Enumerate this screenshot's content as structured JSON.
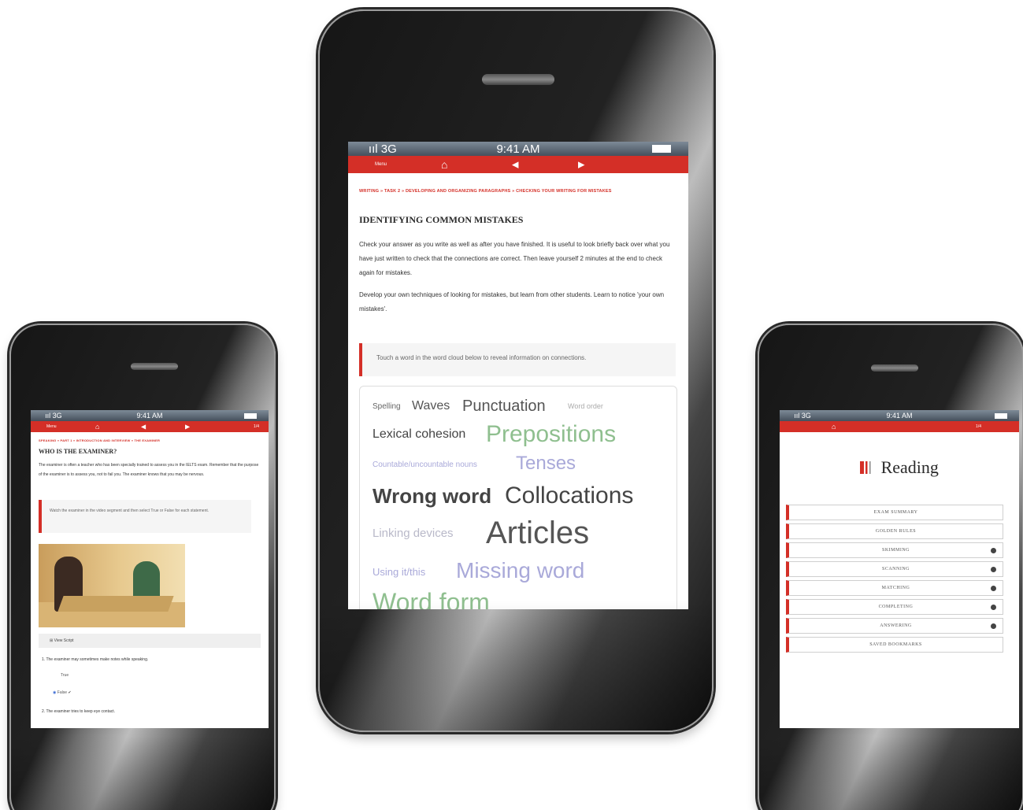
{
  "center": {
    "status": {
      "signal": "ııl 3G",
      "time": "9:41 AM"
    },
    "nav": {
      "menu": "Menu",
      "home_icon": "home-icon",
      "back_icon": "left-arrow-icon",
      "forward_icon": "right-arrow-icon"
    },
    "breadcrumb": "WRITING » TASK 2 » DEVELOPING AND ORGANIZING PARAGRAPHS » CHECKING YOUR WRITING FOR MISTAKES",
    "title": "IDENTIFYING COMMON MISTAKES",
    "paragraph1": "Check your answer as you write as well as after you have finished. It is useful to look briefly back over what you have just written to check that the connections are correct. Then leave yourself 2 minutes at the end to check again for mistakes.",
    "paragraph2": "Develop your own techniques of looking for mistakes, but learn from other students. Learn to notice 'your own mistakes'.",
    "callout": "Touch a word in the word cloud below to reveal information on connections.",
    "cloud": {
      "spelling": "Spelling",
      "waves": "Waves",
      "punctuation": "Punctuation",
      "word_order": "Word order",
      "lexical_cohesion": "Lexical cohesion",
      "prepositions": "Prepositions",
      "countable": "Countable/uncountable nouns",
      "tenses": "Tenses",
      "wrong_word": "Wrong word",
      "collocations": "Collocations",
      "linking_devices": "Linking devices",
      "articles": "Articles",
      "using_itthis": "Using it/this",
      "missing_word": "Missing word",
      "word_form": "Word form"
    },
    "colors": {
      "accent": "#d42f27",
      "green": "#8fbf8f",
      "lavender": "#a9a9d9",
      "gray_light": "#b9b9c9"
    }
  },
  "left": {
    "status": {
      "signal": "ııl 3G",
      "time": "9:41 AM"
    },
    "nav": {
      "menu": "Menu",
      "home_icon": "home-icon",
      "back_icon": "left-arrow-icon",
      "forward_icon": "right-arrow-icon",
      "extra": "1/4"
    },
    "breadcrumb": "SPEAKING » PART 1 » INTRODUCTION AND INTERVIEW » THE EXAMINER",
    "title": "WHO IS THE EXAMINER?",
    "paragraph": "The examiner is often a teacher who has been specially trained to assess you in the IELTS exam. Remember that the purpose of the examiner is to assess you, not to fail you. The examiner knows that you may be nervous.",
    "callout": "Watch the examiner in the video segment and then select True or False for each statement.",
    "video_toggle": "View Script",
    "q1": "1. The examiner may sometimes make notes while speaking.",
    "opt_true": "True",
    "opt_false": "False ✔",
    "q2": "2. The examiner tries to keep eye contact."
  },
  "right": {
    "status": {
      "signal": "ııl 3G",
      "time": "9:41 AM"
    },
    "nav": {
      "home_icon": "home-icon",
      "extra": "1/4"
    },
    "title": "Reading",
    "menu": [
      "EXAM SUMMARY",
      "GOLDEN RULES",
      "SKIMMING",
      "SCANNING",
      "MATCHING",
      "COMPLETING",
      "ANSWERING",
      "SAVED BOOKMARKS"
    ],
    "dots": [
      false,
      false,
      true,
      true,
      true,
      true,
      true,
      false
    ]
  }
}
